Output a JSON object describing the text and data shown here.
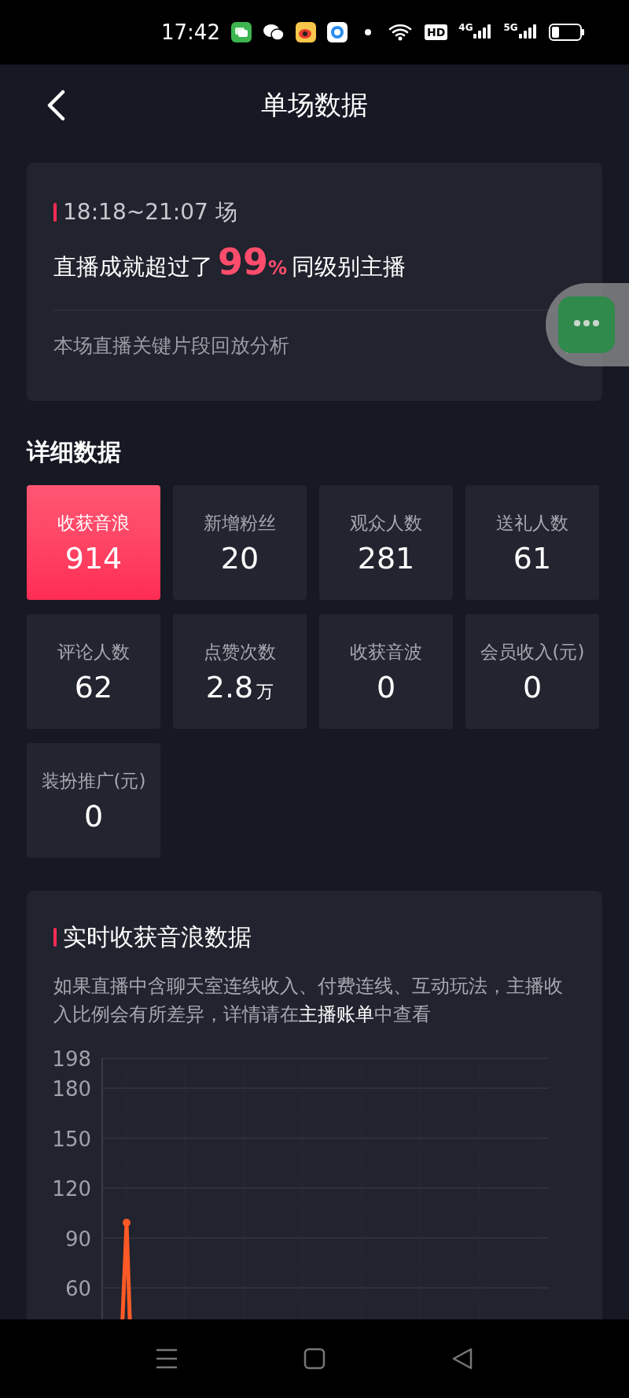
{
  "status_bar": {
    "time": "17:42",
    "network_labels": [
      "HD",
      "4G",
      "5G"
    ]
  },
  "header": {
    "title": "单场数据"
  },
  "summary": {
    "session": "18:18~21:07 场",
    "headline_before": "直播成就超过了",
    "percent": "99",
    "percent_sign": "%",
    "headline_after": "同级别主播",
    "link": "本场直播关键片段回放分析"
  },
  "details": {
    "title": "详细数据",
    "stats": [
      {
        "label": "收获音浪",
        "value": "914",
        "selected": true
      },
      {
        "label": "新增粉丝",
        "value": "20",
        "selected": false
      },
      {
        "label": "观众人数",
        "value": "281",
        "selected": false
      },
      {
        "label": "送礼人数",
        "value": "61",
        "selected": false
      },
      {
        "label": "评论人数",
        "value": "62",
        "selected": false
      },
      {
        "label": "点赞次数",
        "value": "2.8",
        "unit": "万",
        "selected": false
      },
      {
        "label": "收获音波",
        "value": "0",
        "selected": false
      },
      {
        "label": "会员收入(元)",
        "value": "0",
        "selected": false
      },
      {
        "label": "装扮推广(元)",
        "value": "0",
        "selected": false
      }
    ]
  },
  "realtime": {
    "title": "实时收获音浪数据",
    "note_before": "如果直播中含聊天室连线收入、付费连线、互动玩法，主播收入比例会有所差异，详情请在",
    "note_link": "主播账单",
    "note_after": "中查看",
    "chart": {
      "y_ticks": [
        "198",
        "180",
        "150",
        "120",
        "90",
        "60"
      ]
    }
  }
}
